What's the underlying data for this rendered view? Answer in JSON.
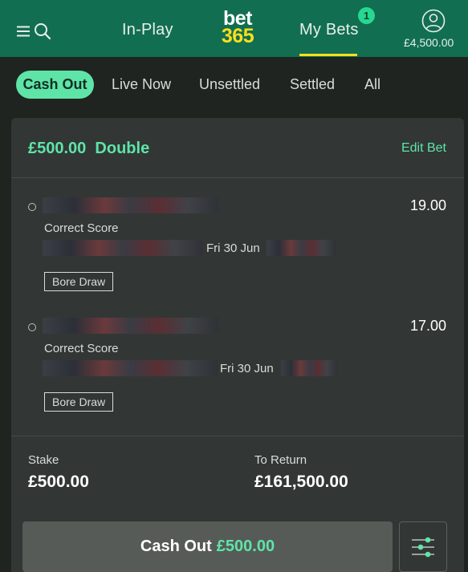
{
  "header": {
    "tabs": {
      "in_play": "In-Play",
      "my_bets": "My Bets"
    },
    "my_bets_badge": "1",
    "logo": {
      "line1": "bet",
      "line2": "365"
    },
    "balance": "£4,500.00",
    "icons": [
      "menu-icon",
      "search-icon",
      "account-icon"
    ]
  },
  "filters": {
    "cash_out": "Cash Out",
    "live_now": "Live Now",
    "unsettled": "Unsettled",
    "settled": "Settled",
    "all": "All",
    "active": "Cash Out"
  },
  "bet": {
    "stake_type": "£500.00",
    "bet_type": "Double",
    "edit_label": "Edit Bet",
    "selections": [
      {
        "odds": "19.00",
        "market": "Correct Score",
        "date": "Fri 30 Jun",
        "selection": "Bore Draw"
      },
      {
        "odds": "17.00",
        "market": "Correct Score",
        "date": "Fri 30 Jun",
        "selection": "Bore Draw"
      }
    ],
    "stake_label": "Stake",
    "stake_value": "£500.00",
    "return_label": "To Return",
    "return_value": "£161,500.00",
    "cashout_label": "Cash Out",
    "cashout_amount": "£500.00"
  },
  "colors": {
    "header_green": "#126e51",
    "accent_green": "#5fe4a8",
    "logo_yellow": "#ffdf1b",
    "background": "#1f2421",
    "card": "#323735"
  }
}
